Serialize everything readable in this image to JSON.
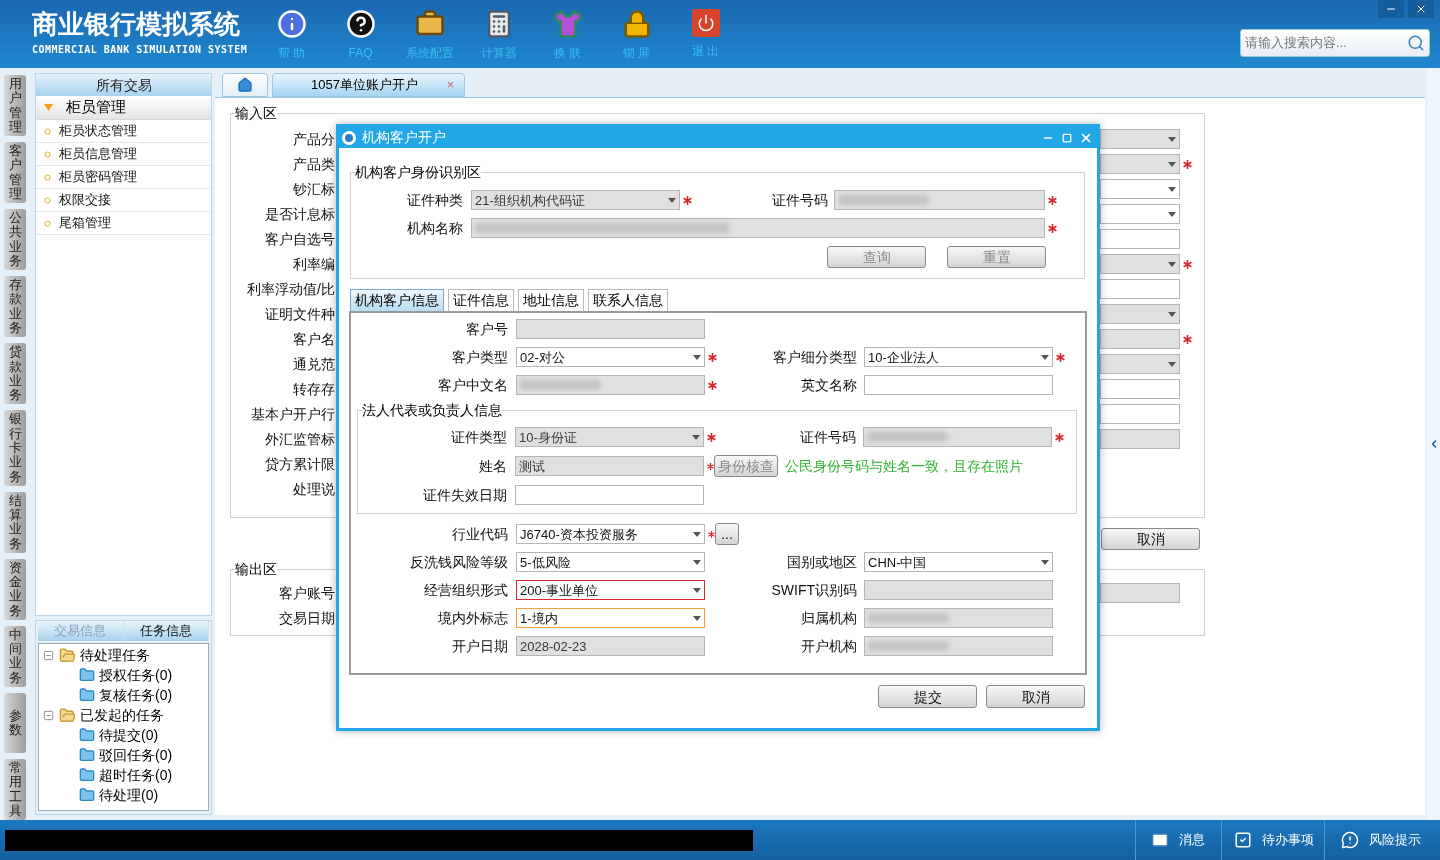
{
  "header": {
    "title": "商业银行模拟系统",
    "subtitle": "COMMERCIAL BANK SIMULATION SYSTEM",
    "toolbar": [
      {
        "label": "帮 助"
      },
      {
        "label": "FAQ"
      },
      {
        "label": "系统配置"
      },
      {
        "label": "计算器"
      },
      {
        "label": "换 肤"
      },
      {
        "label": "锁 屏"
      },
      {
        "label": "退 出"
      }
    ],
    "search": {
      "placeholder": "请输入搜索内容..."
    }
  },
  "rail": {
    "tabs": [
      {
        "label": "用户管理"
      },
      {
        "label": "客户管理"
      },
      {
        "label": "公共业务"
      },
      {
        "label": "存款业务"
      },
      {
        "label": "贷款业务"
      },
      {
        "label": "银行卡业务"
      },
      {
        "label": "结算业务"
      },
      {
        "label": "资金业务"
      },
      {
        "label": "中间业务"
      },
      {
        "label": "参数"
      },
      {
        "label": "常用工具"
      }
    ]
  },
  "sidebar": {
    "title": "所有交易",
    "group": {
      "label": "柜员管理",
      "expanded": true,
      "items": [
        {
          "label": "柜员状态管理"
        },
        {
          "label": "柜员信息管理"
        },
        {
          "label": "柜员密码管理"
        },
        {
          "label": "权限交接"
        },
        {
          "label": "尾箱管理"
        }
      ]
    },
    "panel_tabs": [
      {
        "label": "交易信息",
        "selected": false
      },
      {
        "label": "任务信息",
        "selected": true
      }
    ],
    "tree": [
      {
        "label": "待处理任务",
        "expanded": true,
        "children": [
          {
            "label": "授权任务(0)"
          },
          {
            "label": "复核任务(0)"
          }
        ]
      },
      {
        "label": "已发起的任务",
        "expanded": true,
        "children": [
          {
            "label": "待提交(0)"
          },
          {
            "label": "驳回任务(0)"
          },
          {
            "label": "超时任务(0)"
          },
          {
            "label": "待处理(0)"
          }
        ]
      }
    ]
  },
  "main": {
    "tabs": [
      {
        "kind": "home",
        "selected": false
      },
      {
        "kind": "page",
        "label": "1057单位账户开户",
        "close": "×",
        "selected": true
      }
    ],
    "input_section": {
      "title": "输入区",
      "rows": [
        {
          "label": "产品分",
          "field": {
            "kind": "select",
            "disabled": true,
            "required": false
          }
        },
        {
          "label": "产品类",
          "field": {
            "kind": "select",
            "disabled": true,
            "required": true
          }
        },
        {
          "label": "钞汇标",
          "field": {
            "kind": "select",
            "disabled": false,
            "required": false
          }
        },
        {
          "label": "是否计息标",
          "field": {
            "kind": "select",
            "disabled": false,
            "required": false
          }
        },
        {
          "label": "客户自选号",
          "field": {
            "kind": "input",
            "disabled": false,
            "required": false
          }
        },
        {
          "label": "利率编",
          "field": {
            "kind": "select",
            "disabled": true,
            "required": true
          }
        },
        {
          "label": "利率浮动值/比",
          "field": {
            "kind": "input",
            "disabled": false,
            "required": false
          }
        },
        {
          "label": "证明文件种",
          "field": {
            "kind": "select",
            "disabled": true,
            "required": false
          }
        },
        {
          "label": "客户名",
          "field": {
            "kind": "input",
            "disabled": true,
            "required": true
          }
        },
        {
          "label": "通兑范",
          "field": {
            "kind": "select",
            "disabled": true,
            "required": false
          }
        },
        {
          "label": "转存存",
          "field": {
            "kind": "input",
            "disabled": false,
            "required": false
          }
        },
        {
          "label": "基本户开户行",
          "field": {
            "kind": "input",
            "disabled": false,
            "required": false
          }
        },
        {
          "label": "外汇监管标",
          "field": {
            "kind": "input",
            "disabled": true,
            "required": false
          }
        },
        {
          "label": "贷方累计限"
        },
        {
          "label": "处理说"
        }
      ]
    },
    "cancel_button": {
      "label": "取消",
      "disabled": false
    },
    "output_section": {
      "title": "输出区",
      "rows": [
        {
          "label": "客户账号",
          "field": {
            "kind": "input",
            "disabled": true,
            "required": false
          }
        },
        {
          "label": "交易日期"
        }
      ]
    }
  },
  "dialog": {
    "title": "机构客户开户",
    "identity": {
      "title": "机构客户身份识别区",
      "rows": [
        {
          "cells": [
            {
              "label": "证件种类",
              "kind": "select",
              "value": "21-组织机构代码证",
              "disabled": true,
              "required": true
            },
            {
              "label": "证件号码",
              "kind": "input",
              "blurred": true,
              "disabled": true,
              "required": true
            }
          ]
        },
        {
          "cells": [
            {
              "label": "机构名称",
              "kind": "input",
              "blurred": true,
              "disabled": true,
              "required": true
            }
          ]
        }
      ],
      "buttons": [
        {
          "label": "查询",
          "disabled": true
        },
        {
          "label": "重置",
          "disabled": true
        }
      ]
    },
    "tabs": [
      {
        "label": "机构客户信息",
        "selected": true
      },
      {
        "label": "证件信息",
        "selected": false
      },
      {
        "label": "地址信息",
        "selected": false
      },
      {
        "label": "联系人信息",
        "selected": false
      }
    ],
    "info_rows": [
      {
        "kind": "fields",
        "cells": [
          {
            "label": "客户号",
            "kind": "input",
            "disabled": true,
            "required": false
          }
        ]
      },
      {
        "kind": "fields",
        "cells": [
          {
            "label": "客户类型",
            "kind": "select",
            "value": "02-对公",
            "disabled": false,
            "required": true
          },
          {
            "label": "客户细分类型",
            "kind": "select",
            "value": "10-企业法人",
            "disabled": false,
            "required": true
          }
        ]
      },
      {
        "kind": "fields",
        "cells": [
          {
            "label": "客户中文名",
            "kind": "input",
            "blurred": true,
            "disabled": true,
            "required": true
          },
          {
            "label": "英文名称",
            "kind": "input",
            "disabled": false,
            "required": false
          }
        ]
      },
      {
        "kind": "group",
        "legend": "法人代表或负责人信息",
        "rows": [
          {
            "cells": [
              {
                "label": "证件类型",
                "kind": "select",
                "value": "10-身份证",
                "disabled": true,
                "required": true
              },
              {
                "label": "证件号码",
                "kind": "input",
                "blurred": true,
                "disabled": true,
                "required": true
              }
            ]
          },
          {
            "cells": [
              {
                "label": "姓名",
                "kind": "input",
                "value": "测试",
                "disabled": true,
                "required": true,
                "action": {
                  "label": "身份核查",
                  "disabled": true
                },
                "note": "公民身份号码与姓名一致，且存在照片"
              }
            ]
          },
          {
            "cells": [
              {
                "label": "证件失效日期",
                "kind": "input",
                "disabled": false,
                "required": false
              }
            ]
          }
        ]
      },
      {
        "kind": "fields",
        "cells": [
          {
            "label": "行业代码",
            "kind": "select",
            "value": "J6740-资本投资服务",
            "disabled": false,
            "required": true,
            "action": {
              "label": "...",
              "disabled": false
            }
          }
        ]
      },
      {
        "kind": "fields",
        "cells": [
          {
            "label": "反洗钱风险等级",
            "kind": "select",
            "value": "5-低风险",
            "disabled": false,
            "required": false
          },
          {
            "label": "国别或地区",
            "kind": "select",
            "value": "CHN-中国",
            "disabled": false,
            "required": false
          }
        ]
      },
      {
        "kind": "fields",
        "cells": [
          {
            "label": "经营组织形式",
            "kind": "select",
            "value": "200-事业单位",
            "disabled": false,
            "required": false,
            "invalid": true
          },
          {
            "label": "SWIFT识别码",
            "kind": "input",
            "disabled": true,
            "required": false
          }
        ]
      },
      {
        "kind": "fields",
        "cells": [
          {
            "label": "境内外标志",
            "kind": "select",
            "value": "1-境内",
            "disabled": false,
            "required": false,
            "focused": true
          },
          {
            "label": "归属机构",
            "kind": "input",
            "blurred": true,
            "disabled": true,
            "required": false
          }
        ]
      },
      {
        "kind": "fields",
        "cells": [
          {
            "label": "开户日期",
            "kind": "input",
            "value": "2028-02-23",
            "disabled": true,
            "required": false
          },
          {
            "label": "开户机构",
            "kind": "input",
            "blurred": true,
            "disabled": true,
            "required": false
          }
        ]
      }
    ],
    "buttons": [
      {
        "label": "提交",
        "disabled": false
      },
      {
        "label": "取消",
        "disabled": false
      }
    ]
  },
  "status_bar": {
    "items": [
      {
        "label": "消息"
      },
      {
        "label": "待办事项"
      },
      {
        "label": "风险提示"
      }
    ]
  }
}
